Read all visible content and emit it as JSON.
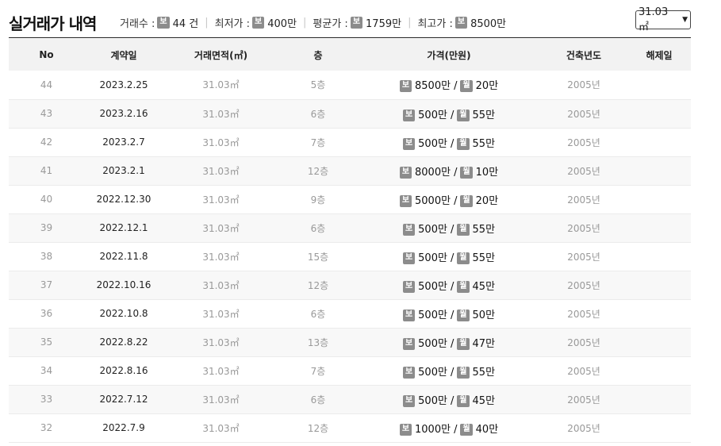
{
  "header": {
    "title": "실거래가 내역",
    "stats": {
      "count_label": "거래수 :",
      "count_value": "44 건",
      "min_label": "최저가 :",
      "min_value": "400만",
      "avg_label": "평균가 :",
      "avg_value": "1759만",
      "max_label": "최고가 :",
      "max_value": "8500만",
      "deposit_badge": "보"
    },
    "area_select": {
      "selected": "31.03 ㎡"
    }
  },
  "table": {
    "columns": [
      "No",
      "계약일",
      "거래면적(㎡)",
      "층",
      "가격(만원)",
      "건축년도",
      "해제일"
    ],
    "deposit_badge": "보",
    "monthly_badge": "월",
    "rows": [
      {
        "no": "44",
        "date": "2023.2.25",
        "area": "31.03㎡",
        "floor": "5층",
        "deposit": "8500만",
        "monthly": "20만",
        "year": "2005년",
        "cancel": ""
      },
      {
        "no": "43",
        "date": "2023.2.16",
        "area": "31.03㎡",
        "floor": "6층",
        "deposit": "500만",
        "monthly": "55만",
        "year": "2005년",
        "cancel": ""
      },
      {
        "no": "42",
        "date": "2023.2.7",
        "area": "31.03㎡",
        "floor": "7층",
        "deposit": "500만",
        "monthly": "55만",
        "year": "2005년",
        "cancel": ""
      },
      {
        "no": "41",
        "date": "2023.2.1",
        "area": "31.03㎡",
        "floor": "12층",
        "deposit": "8000만",
        "monthly": "10만",
        "year": "2005년",
        "cancel": ""
      },
      {
        "no": "40",
        "date": "2022.12.30",
        "area": "31.03㎡",
        "floor": "9층",
        "deposit": "5000만",
        "monthly": "20만",
        "year": "2005년",
        "cancel": ""
      },
      {
        "no": "39",
        "date": "2022.12.1",
        "area": "31.03㎡",
        "floor": "6층",
        "deposit": "500만",
        "monthly": "55만",
        "year": "2005년",
        "cancel": ""
      },
      {
        "no": "38",
        "date": "2022.11.8",
        "area": "31.03㎡",
        "floor": "15층",
        "deposit": "500만",
        "monthly": "55만",
        "year": "2005년",
        "cancel": ""
      },
      {
        "no": "37",
        "date": "2022.10.16",
        "area": "31.03㎡",
        "floor": "12층",
        "deposit": "500만",
        "monthly": "45만",
        "year": "2005년",
        "cancel": ""
      },
      {
        "no": "36",
        "date": "2022.10.8",
        "area": "31.03㎡",
        "floor": "6층",
        "deposit": "500만",
        "monthly": "50만",
        "year": "2005년",
        "cancel": ""
      },
      {
        "no": "35",
        "date": "2022.8.22",
        "area": "31.03㎡",
        "floor": "13층",
        "deposit": "500만",
        "monthly": "47만",
        "year": "2005년",
        "cancel": ""
      },
      {
        "no": "34",
        "date": "2022.8.16",
        "area": "31.03㎡",
        "floor": "7층",
        "deposit": "500만",
        "monthly": "55만",
        "year": "2005년",
        "cancel": ""
      },
      {
        "no": "33",
        "date": "2022.7.12",
        "area": "31.03㎡",
        "floor": "6층",
        "deposit": "500만",
        "monthly": "45만",
        "year": "2005년",
        "cancel": ""
      },
      {
        "no": "32",
        "date": "2022.7.9",
        "area": "31.03㎡",
        "floor": "12층",
        "deposit": "1000만",
        "monthly": "40만",
        "year": "2005년",
        "cancel": ""
      }
    ]
  }
}
